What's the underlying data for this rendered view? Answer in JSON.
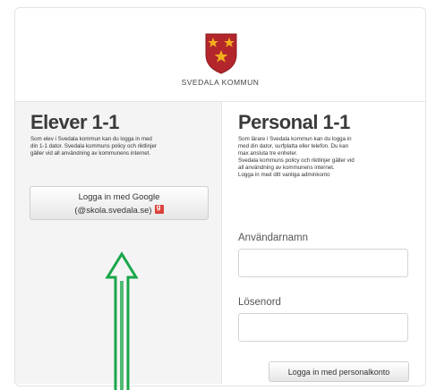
{
  "header": {
    "brand": "SVEDALA KOMMUN",
    "crest_icon": "coat-of-arms-icon",
    "crest_color": "#b3262c",
    "crest_star_color": "#f2b01e"
  },
  "students": {
    "title": "Elever 1-1",
    "description": "Som elev i Svedala kommun kan du logga in med\ndin 1-1 dator. Svedala kommuns policy och riktlinjer\ngäller vid all användning av kommunens internet.",
    "google_button": {
      "line1": "Logga in med Google",
      "line2": "(@skola.svedala.se)",
      "icon": "google-icon"
    }
  },
  "staff": {
    "title": "Personal 1-1",
    "description": "Som lärare i Svedala kommun kan du logga in\nmed din dator, surfplatta eller telefon. Du kan\nmax ansluta tre enheter.\nSvedala kommuns policy och riktlinjer gäller vid\nall användning av kommunens internet.\nLogga in med ditt vanliga adminkonto",
    "username_label": "Användarnamn",
    "username_value": "",
    "password_label": "Lösenord",
    "password_value": "",
    "login_button": "Logga in med personalkonto"
  },
  "annotation": {
    "arrow_icon": "green-arrow-up-icon",
    "arrow_color": "#1aa64a"
  }
}
